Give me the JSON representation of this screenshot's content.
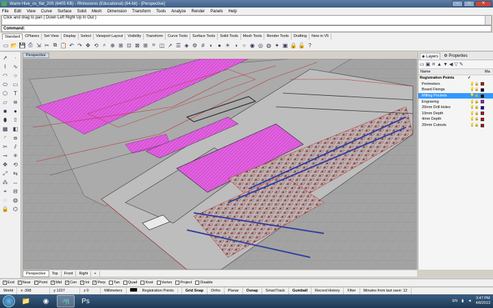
{
  "window": {
    "title": "Warre Hive_os_flat_20S (6405 KB) - Rhinoceros (Educational) (64-bit) - [Perspective]"
  },
  "menu": [
    "File",
    "Edit",
    "View",
    "Curve",
    "Surface",
    "Solid",
    "Mesh",
    "Dimension",
    "Transform",
    "Tools",
    "Analyze",
    "Render",
    "Panels",
    "Help"
  ],
  "command": {
    "history": "Click and drag to pan ( Down Left Right Up In Out )",
    "prompt": "Command:",
    "value": ""
  },
  "tabs": [
    "Standard",
    "CPlanes",
    "Set View",
    "Display",
    "Select",
    "Viewport Layout",
    "Visibility",
    "Transform",
    "Curve Tools",
    "Surface Tools",
    "Solid Tools",
    "Mesh Tools",
    "Render Tools",
    "Drafting",
    "New in V5"
  ],
  "active_tab": "Standard",
  "toolbar_icons": [
    "new-icon",
    "open-icon",
    "save-icon",
    "print-icon",
    "import-icon",
    "cut-icon",
    "copy-icon",
    "paste-icon",
    "undo-icon",
    "redo-icon",
    "pan-icon",
    "rotate-icon",
    "zoom-icon",
    "zoom-window-icon",
    "zoom-extents-icon",
    "zoom-selected-icon",
    "zoom-all-icon",
    "4-view-icon",
    "cplane-icon",
    "set-view-icon",
    "select-icon",
    "properties-icon",
    "layer-icon",
    "object-props-icon",
    "grid-icon",
    "render-icon",
    "material-icon",
    "sun-icon",
    "shade-icon",
    "ghost-icon",
    "rendered-icon",
    "xray-icon",
    "environment-icon",
    "light-icon",
    "snapshot-icon",
    "lock-icon",
    "unlock-icon",
    "help-icon"
  ],
  "left_icons": [
    "select-arrow-icon",
    "point-icon",
    "polyline-icon",
    "curve-icon",
    "arc-icon",
    "circle-icon",
    "ellipse-icon",
    "rectangle-icon",
    "polygon-icon",
    "text-icon",
    "surface-icon",
    "loft-icon",
    "box-icon",
    "sphere-icon",
    "cylinder-icon",
    "extrude-icon",
    "mesh-icon",
    "boolean-icon",
    "fillet-icon",
    "offset-icon",
    "trim-icon",
    "split-icon",
    "join-icon",
    "explode-icon",
    "move-icon",
    "rotate-icon",
    "scale-icon",
    "mirror-icon",
    "array-icon",
    "dimension-icon",
    "snap-icon",
    "group-icon",
    "hide-icon",
    "show-icon",
    "lock-icon",
    "analyze-icon"
  ],
  "viewport": {
    "label": "Perspective",
    "tabs": [
      "Perspective",
      "Top",
      "Front",
      "Right",
      "+"
    ],
    "active": "Perspective"
  },
  "panel": {
    "tabs": [
      "Layers",
      "Properties"
    ],
    "header": {
      "name": "Name",
      "mat": "Ma"
    },
    "layers": [
      {
        "name": "Registration Points",
        "check": "✓",
        "color": "#000000",
        "parent": true
      },
      {
        "name": "Perimeters",
        "color": "#ff0000"
      },
      {
        "name": "Board Fixings",
        "color": "#000000"
      },
      {
        "name": "Milling Pockets",
        "color": "#000000",
        "selected": true
      },
      {
        "name": "Engraving",
        "color": "#ff00ff"
      },
      {
        "name": "20mm Drill Holes",
        "color": "#0000ff"
      },
      {
        "name": "10mm Depth",
        "color": "#ff0000"
      },
      {
        "name": "4mm Depth",
        "color": "#ff0000"
      },
      {
        "name": "20mm Cutouts",
        "color": "#ff0000"
      }
    ]
  },
  "osnaps": [
    {
      "label": "End",
      "on": true
    },
    {
      "label": "Near",
      "on": true
    },
    {
      "label": "Point",
      "on": true
    },
    {
      "label": "Mid",
      "on": true
    },
    {
      "label": "Cen",
      "on": true
    },
    {
      "label": "Int",
      "on": true
    },
    {
      "label": "Perp",
      "on": true
    },
    {
      "label": "Tan",
      "on": false
    },
    {
      "label": "Quad",
      "on": false
    },
    {
      "label": "Knot",
      "on": false
    },
    {
      "label": "Vertex",
      "on": false
    },
    {
      "label": "Project",
      "on": false
    },
    {
      "label": "Disable",
      "on": false
    }
  ],
  "status": {
    "cplane": "World",
    "x": "x -398",
    "y": "y 1227",
    "z": "z 0",
    "units": "Millimeters",
    "layer": "Registration Points",
    "grid_snap": "Grid Snap",
    "ortho": "Ortho",
    "planar": "Planar",
    "osnap": "Osnap",
    "smarttrack": "SmartTrack",
    "gumball": "Gumball",
    "history": "Record History",
    "filter": "Filter",
    "save": "Minutes from last save: 12"
  },
  "taskbar": {
    "lang": "EN",
    "time": "3:47 PM",
    "date": "4/8/2013"
  }
}
